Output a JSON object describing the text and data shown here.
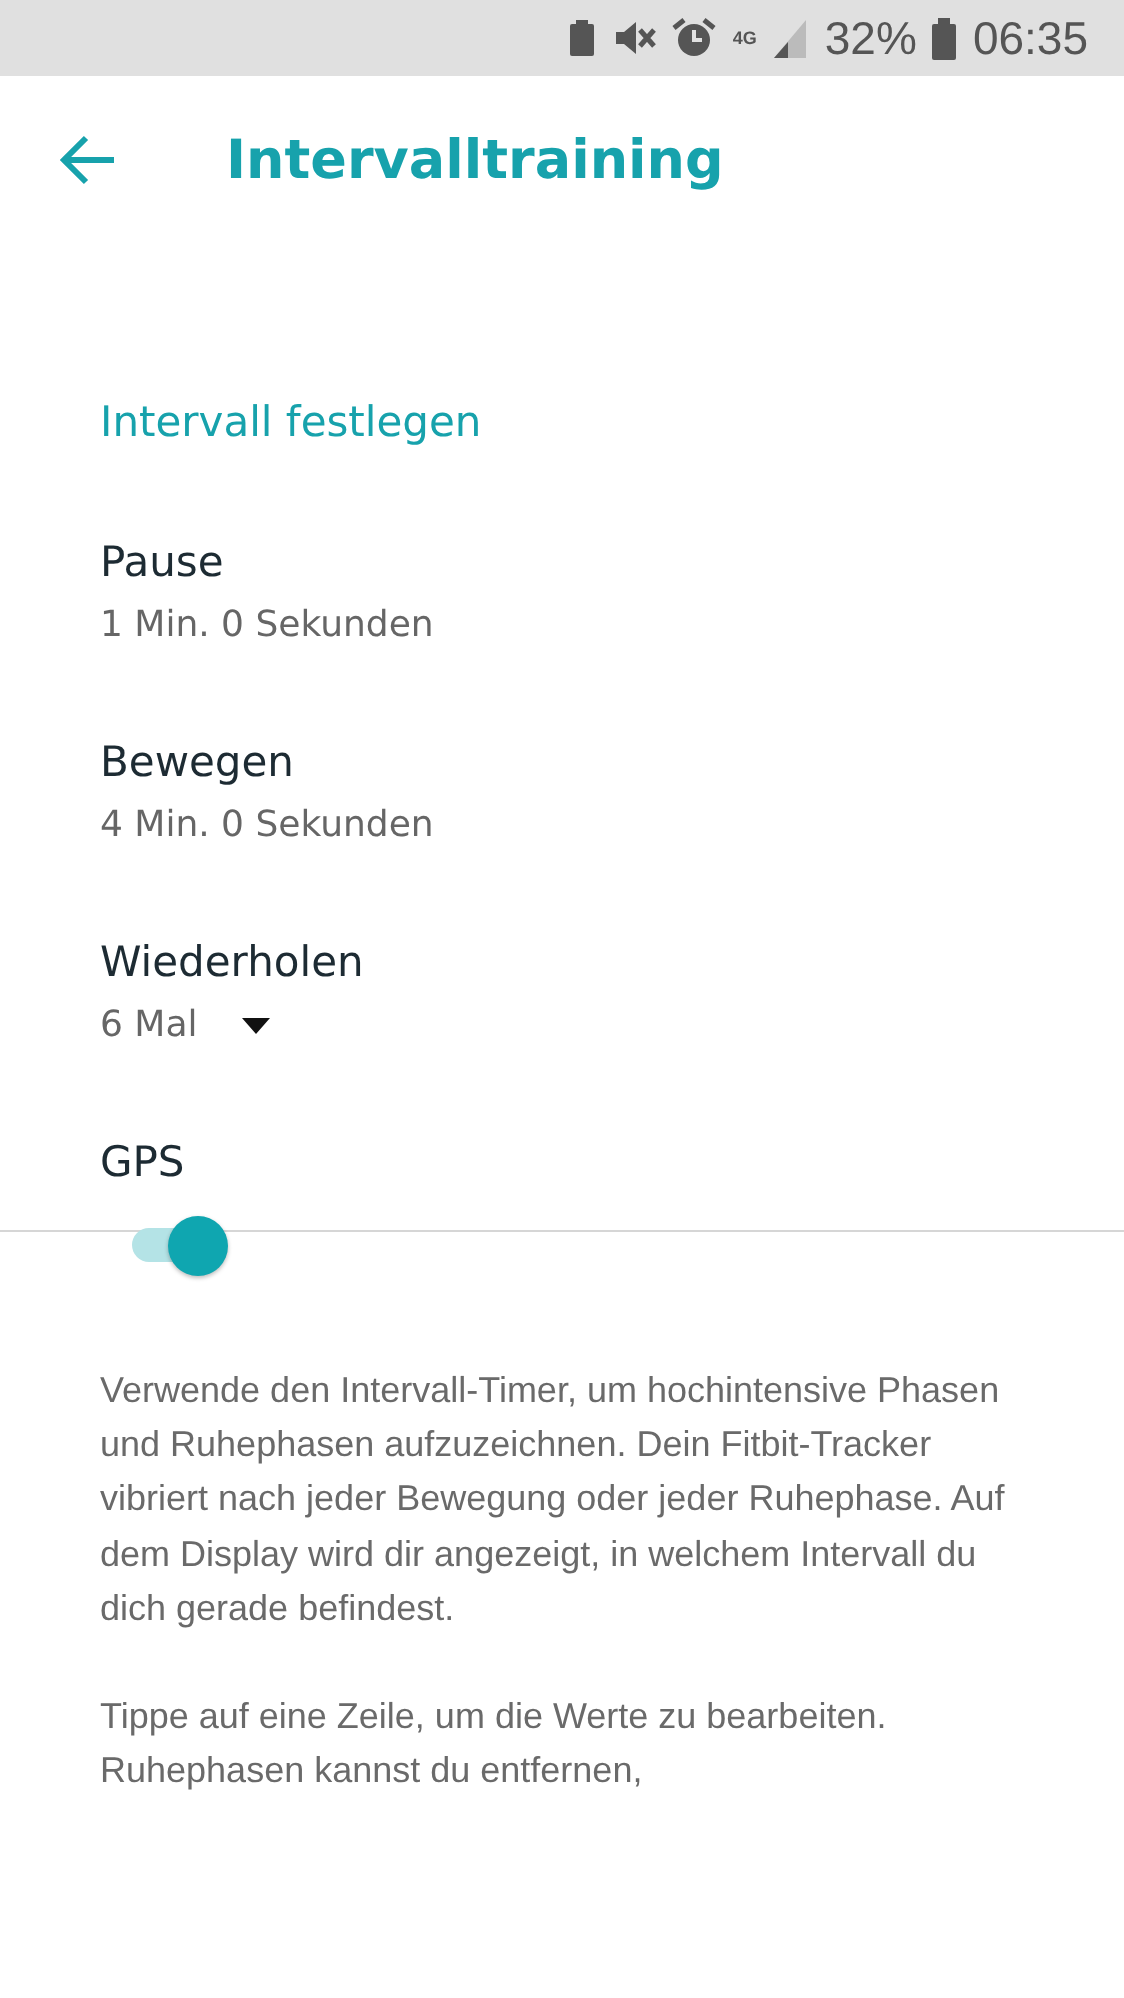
{
  "status_bar": {
    "network": "4G",
    "battery": "32%",
    "time": "06:35"
  },
  "header": {
    "title": "Intervalltraining"
  },
  "section": {
    "title": "Intervall festlegen"
  },
  "settings": [
    {
      "kind": "value",
      "label": "Pause",
      "value": "1 Min. 0 Sekunden"
    },
    {
      "kind": "value",
      "label": "Bewegen",
      "value": "4 Min. 0 Sekunden"
    },
    {
      "kind": "dropdown",
      "label": "Wiederholen",
      "value": "6 Mal"
    },
    {
      "kind": "toggle",
      "label": "GPS",
      "on": true
    }
  ],
  "description": [
    "Verwende den Intervall-Timer, um hochintensive Phasen und Ruhephasen aufzuzeichnen. Dein Fitbit-Tracker vibriert nach jeder Bewegung oder jeder Ruhephase. Auf dem Display wird dir angezeigt, in welchem Intervall du dich gerade befindest.",
    "Tippe auf eine Zeile, um die Werte zu bearbeiten. Ruhephasen kannst du entfernen,"
  ]
}
